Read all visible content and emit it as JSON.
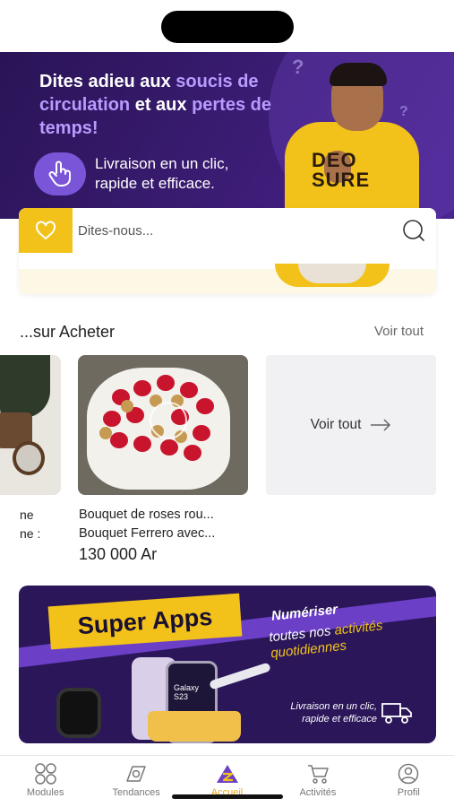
{
  "hero": {
    "title_prefix": "Dites adieu aux ",
    "title_hl1": "soucis de circulation",
    "title_mid": " et aux ",
    "title_hl2": "pertes de temps!",
    "subtitle": "Livraison en un clic, rapide et efficace.",
    "shirt_text": "DEO\nSURE",
    "slides_total": 4,
    "slide_active": 1
  },
  "search": {
    "placeholder": "Dites-nous..."
  },
  "section": {
    "title": "...sur Acheter",
    "see_all": "Voir tout"
  },
  "products": [
    {
      "line1": "ne",
      "line2": "ne :"
    },
    {
      "name1": "Bouquet de roses rou...",
      "name2": "Bouquet Ferrero avec...",
      "price": "130 000 Ar"
    }
  ],
  "see_all_card": {
    "label": "Voir tout"
  },
  "promo": {
    "tag": "Super Apps",
    "line1": "Numériser",
    "line2_a": "toutes nos ",
    "line2_b": "activités quotidiennes",
    "phone_text": "Galaxy S23",
    "delivery": "Livraison en un clic, rapide et efficace"
  },
  "nav": [
    {
      "label": "Modules",
      "icon": "grid-icon"
    },
    {
      "label": "Tendances",
      "icon": "compass-icon"
    },
    {
      "label": "Accueil",
      "icon": "home-logo-icon",
      "active": true
    },
    {
      "label": "Activités",
      "icon": "cart-icon"
    },
    {
      "label": "Profil",
      "icon": "profile-icon"
    }
  ],
  "colors": {
    "accent": "#f2c21a",
    "brand_purple": "#3b1c74",
    "active_nav": "#e9a51a"
  }
}
